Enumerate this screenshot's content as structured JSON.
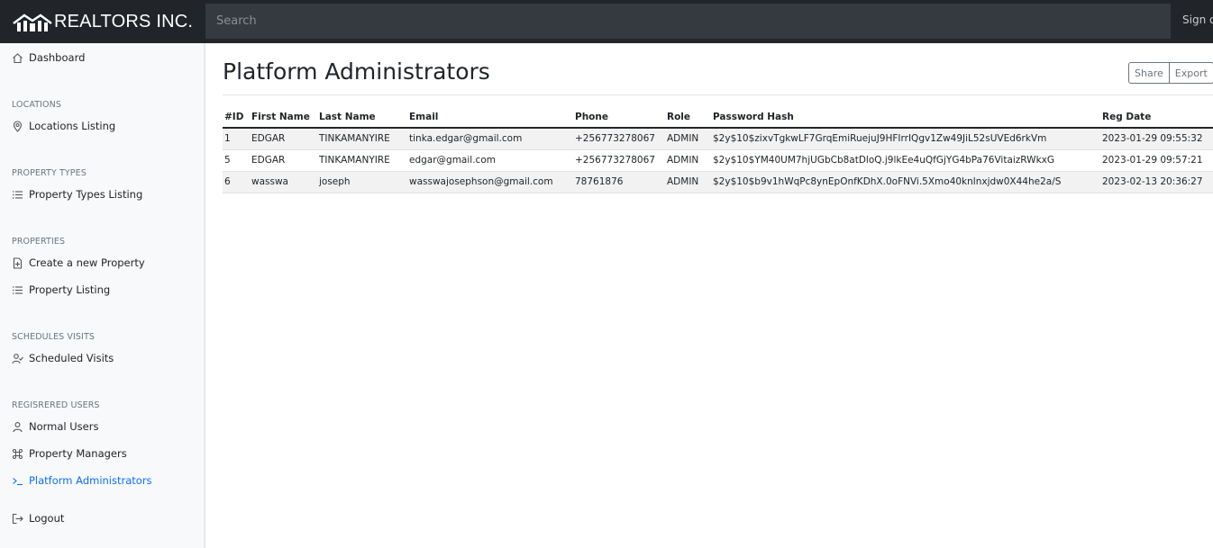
{
  "brand": {
    "name": "REALTORS INC."
  },
  "search": {
    "placeholder": "Search"
  },
  "header": {
    "signout_label": "Sign out"
  },
  "sidebar": {
    "dashboard": "Dashboard",
    "sections": [
      {
        "heading": "LOCATIONS",
        "items": [
          "Locations Listing"
        ]
      },
      {
        "heading": "PROPERTY TYPES",
        "items": [
          "Property Types Listing"
        ]
      },
      {
        "heading": "PROPERTIES",
        "items": [
          "Create a new Property",
          "Property Listing"
        ]
      },
      {
        "heading": "SCHEDULES VISITS",
        "items": [
          "Scheduled Visits"
        ]
      },
      {
        "heading": "REGISRERED USERS",
        "items": [
          "Normal Users",
          "Property Managers",
          "Platform Administrators"
        ]
      }
    ],
    "logout": "Logout",
    "active_item": "Platform Administrators",
    "active_color": "#0d6efd"
  },
  "main": {
    "title": "Platform Administrators",
    "share_label": "Share",
    "export_label": "Export",
    "table": {
      "columns": [
        "#ID",
        "First Name",
        "Last Name",
        "Email",
        "Phone",
        "Role",
        "Password Hash",
        "Reg Date"
      ],
      "rows": [
        [
          "1",
          "EDGAR",
          "TINKAMANYIRE",
          "tinka.edgar@gmail.com",
          "+256773278067",
          "ADMIN",
          "$2y$10$zixvTgkwLF7GrqEmiRuejuJ9HFIrrIQgv1Zw49JiL52sUVEd6rkVm",
          "2023-01-29 09:55:32"
        ],
        [
          "5",
          "EDGAR",
          "TINKAMANYIRE",
          "edgar@gmail.com",
          "+256773278067",
          "ADMIN",
          "$2y$10$YM40UM7hjUGbCb8atDloQ.j9lkEe4uQfGjYG4bPa76VitaizRWkxG",
          "2023-01-29 09:57:21"
        ],
        [
          "6",
          "wasswa",
          "joseph",
          "wasswajosephson@gmail.com",
          "78761876",
          "ADMIN",
          "$2y$10$b9v1hWqPc8ynEpOnfKDhX.0oFNVi.5Xmo40knlnxjdw0X44he2a/S",
          "2023-02-13 20:36:27"
        ]
      ]
    }
  },
  "colors": {
    "navbar": "#212529",
    "search_bg": "#343a40",
    "sidebar_bg": "#f8f9fa",
    "accent": "#0d6efd"
  }
}
